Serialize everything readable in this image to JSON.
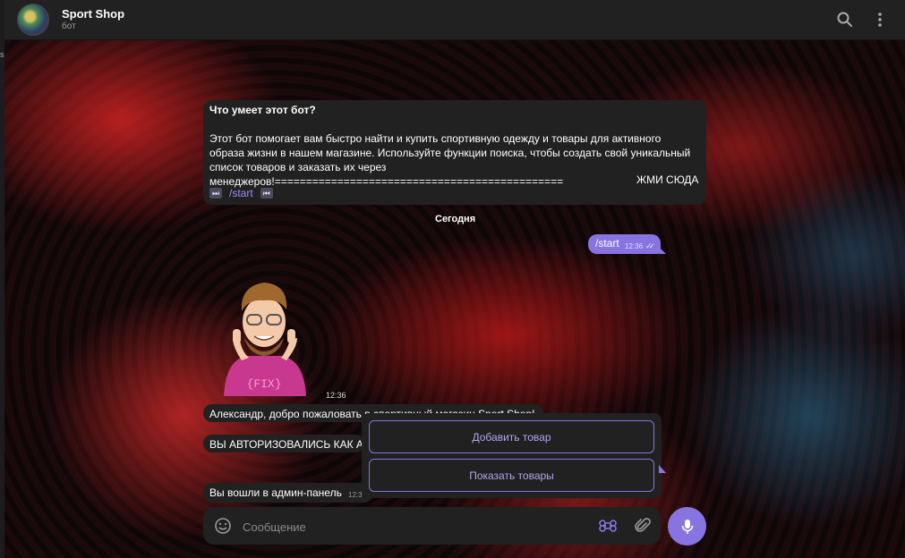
{
  "header": {
    "title": "Sport Shop",
    "subtitle": "бот",
    "icons": [
      "search-icon",
      "more-vertical-icon"
    ]
  },
  "left_strip_text": "s",
  "bot_info": {
    "title": "Что умеет этот бот?",
    "description": "Этот бот помогает вам быстро найти и купить спортивную одежду и товары для активного образа жизни в нашем магазине. Используйте функции поиска, чтобы создать свой уникальный список товаров и заказать их через менеджеров!==============================================",
    "cta": "ЖМИ СЮДА",
    "command": "/start",
    "key_left": "⏭",
    "key_right": "⏮"
  },
  "date_separator": "Сегодня",
  "outgoing": {
    "text": "/start",
    "time": "12:36"
  },
  "sticker": {
    "caption": "{FIX}",
    "time": "12:36"
  },
  "messages": [
    {
      "text": "Александр, добро пожаловать в спортивный магазин Sport Shop!"
    },
    {
      "text": "ВЫ АВТОРИЗОВАЛИСЬ КАК А,"
    },
    {
      "text": "Вы вошли в админ-панель",
      "time": "12:3"
    }
  ],
  "keyboard": {
    "buttons": [
      "Добавить товар",
      "Показать товары"
    ]
  },
  "composer": {
    "placeholder": "Сообщение"
  },
  "colors": {
    "accent": "#8774e1",
    "panel": "#212121",
    "header": "#212121"
  }
}
